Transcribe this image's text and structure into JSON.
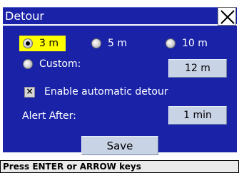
{
  "window": {
    "title": "Detour"
  },
  "distance_options": [
    {
      "label": "3 m",
      "selected": true
    },
    {
      "label": "5 m",
      "selected": false
    },
    {
      "label": "10 m",
      "selected": false
    }
  ],
  "custom": {
    "label": "Custom:",
    "value": "12 m",
    "selected": false
  },
  "auto_detour": {
    "label": "Enable automatic detour",
    "checked": true,
    "mark": "×"
  },
  "alert": {
    "label": "Alert After:",
    "value": "1 min"
  },
  "save_label": "Save",
  "status_text": "Press ENTER or ARROW keys",
  "colors": {
    "panel": "#1a23a8",
    "highlight": "#ffff00",
    "button": "#c9d3e6"
  }
}
